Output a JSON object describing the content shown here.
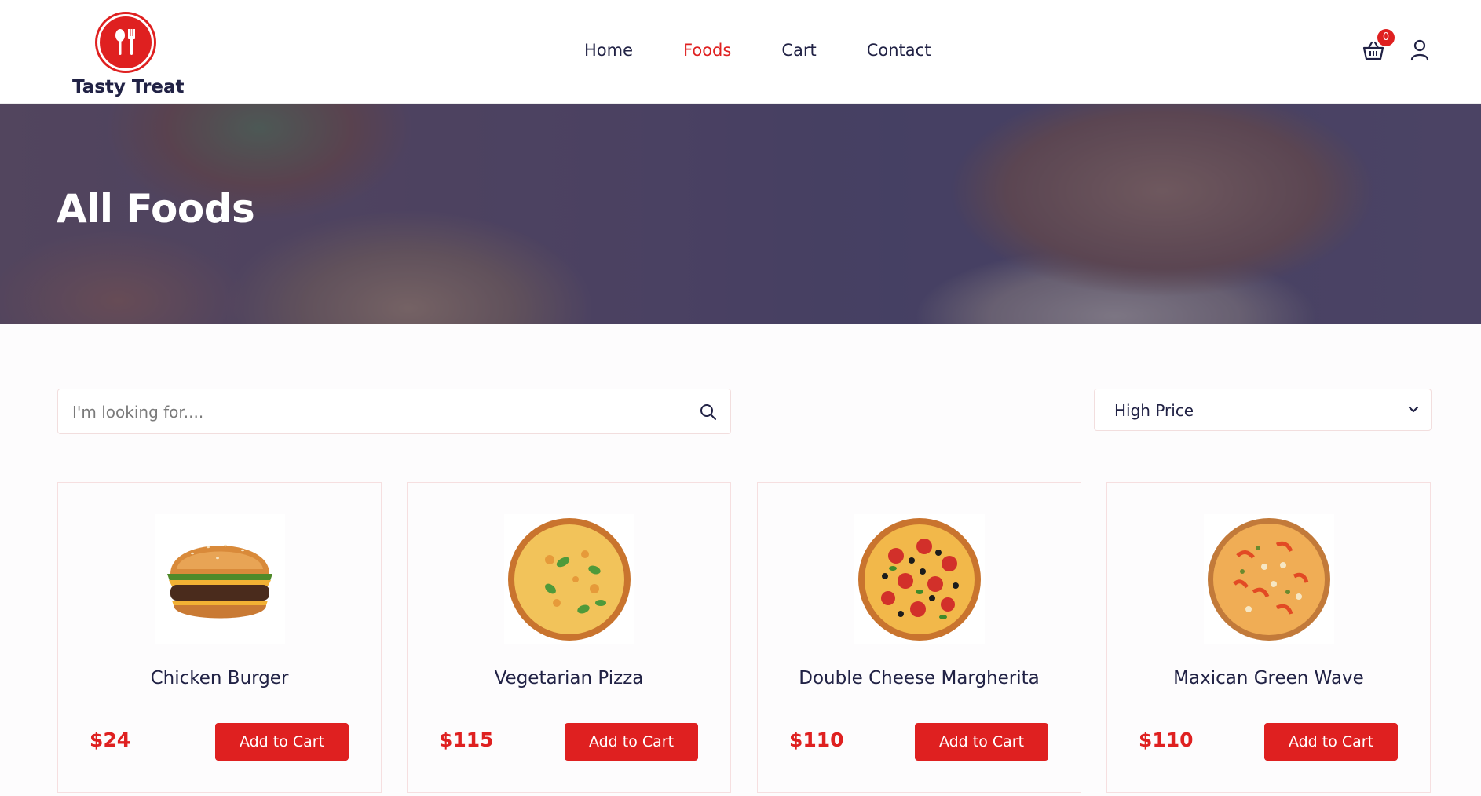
{
  "brand": {
    "name": "Tasty Treat",
    "accent_color": "#df2020",
    "text_color": "#212245"
  },
  "nav": {
    "items": [
      {
        "label": "Home",
        "active": false
      },
      {
        "label": "Foods",
        "active": true
      },
      {
        "label": "Cart",
        "active": false
      },
      {
        "label": "Contact",
        "active": false
      }
    ]
  },
  "header_icons": {
    "cart_icon": "shopping-basket-icon",
    "cart_count": "0",
    "user_icon": "user-icon"
  },
  "banner": {
    "title": "All Foods"
  },
  "search": {
    "placeholder": "I'm looking for....",
    "value": "",
    "icon": "search-icon"
  },
  "sort": {
    "selected": "High Price",
    "icon": "chevron-down-icon"
  },
  "products": [
    {
      "title": "Chicken Burger",
      "price": "$24",
      "button": "Add to Cart",
      "image": "burger"
    },
    {
      "title": "Vegetarian Pizza",
      "price": "$115",
      "button": "Add to Cart",
      "image": "veg-pizza"
    },
    {
      "title": "Double Cheese Margherita",
      "price": "$110",
      "button": "Add to Cart",
      "image": "pepperoni-pizza"
    },
    {
      "title": "Maxican Green Wave",
      "price": "$110",
      "button": "Add to Cart",
      "image": "mexican-pizza"
    }
  ]
}
